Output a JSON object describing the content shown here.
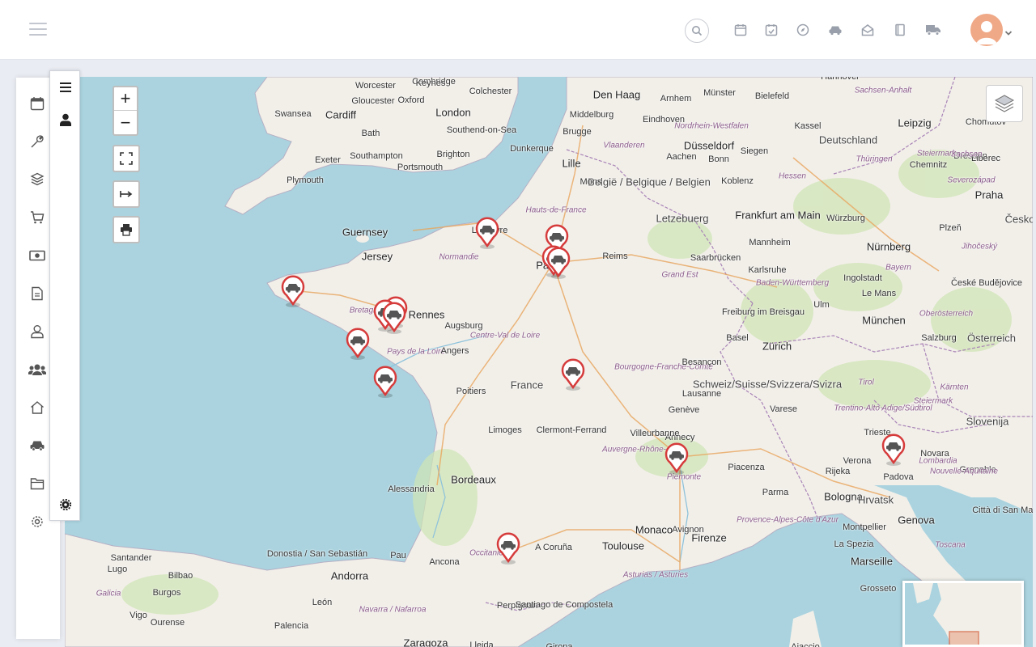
{
  "topbar": {
    "icons": [
      "hamburger-icon",
      "search-icon",
      "calendar-icon",
      "calendar-check-icon",
      "compass-icon",
      "car-icon",
      "envelope-open-icon",
      "book-icon",
      "truck-icon",
      "user-avatar",
      "chevron-down-icon"
    ]
  },
  "sidebar": {
    "items": [
      "calendar-icon",
      "wrench-icon",
      "cube-icon",
      "cart-icon",
      "money-icon",
      "document-icon",
      "user-icon",
      "users-icon",
      "home-icon",
      "car-icon",
      "folder-icon",
      "gear-icon"
    ]
  },
  "panel": {
    "items": [
      "menu-icon",
      "person-icon",
      "settings-icon"
    ]
  },
  "map": {
    "zoom_in": "+",
    "zoom_out": "−",
    "colors": {
      "water": "#aad3df",
      "land": "#f2efe9",
      "forest": "#cfe5b4",
      "marker": "#d63b3b"
    },
    "places": [
      {
        "name": "Den Haag",
        "cls": "big"
      },
      {
        "name": "Cambridge",
        "cls": ""
      },
      {
        "name": "Keynes",
        "cls": ""
      },
      {
        "name": "Worcester",
        "cls": ""
      },
      {
        "name": "Colchester",
        "cls": ""
      },
      {
        "name": "Oxford",
        "cls": ""
      },
      {
        "name": "London",
        "cls": "big"
      },
      {
        "name": "Swansea",
        "cls": ""
      },
      {
        "name": "Cardiff",
        "cls": "big"
      },
      {
        "name": "Gloucester",
        "cls": ""
      },
      {
        "name": "Southend-on-Sea",
        "cls": ""
      },
      {
        "name": "Bath",
        "cls": ""
      },
      {
        "name": "Middelburg",
        "cls": ""
      },
      {
        "name": "Brugge",
        "cls": ""
      },
      {
        "name": "Arnhem",
        "cls": ""
      },
      {
        "name": "Münster",
        "cls": ""
      },
      {
        "name": "Bielefeld",
        "cls": ""
      },
      {
        "name": "Hannover",
        "cls": ""
      },
      {
        "name": "Sachsen-Anhalt",
        "cls": "region"
      },
      {
        "name": "Leipzig",
        "cls": "big"
      },
      {
        "name": "Exeter",
        "cls": ""
      },
      {
        "name": "Southampton",
        "cls": ""
      },
      {
        "name": "Brighton",
        "cls": ""
      },
      {
        "name": "Dunkerque",
        "cls": ""
      },
      {
        "name": "Eindhoven",
        "cls": ""
      },
      {
        "name": "Düsseldorf",
        "cls": "big"
      },
      {
        "name": "Nordrhein-Westfalen",
        "cls": "region"
      },
      {
        "name": "Kassel",
        "cls": ""
      },
      {
        "name": "Deutschland",
        "cls": "country"
      },
      {
        "name": "Plymouth",
        "cls": ""
      },
      {
        "name": "Portsmouth",
        "cls": ""
      },
      {
        "name": "Lille",
        "cls": "big"
      },
      {
        "name": "Vlaanderen",
        "cls": "region"
      },
      {
        "name": "Aachen",
        "cls": ""
      },
      {
        "name": "Siegen",
        "cls": ""
      },
      {
        "name": "Thüringen",
        "cls": "region"
      },
      {
        "name": "Chemnitz",
        "cls": ""
      },
      {
        "name": "Dresden",
        "cls": ""
      },
      {
        "name": "België / Belgique / Belgien",
        "cls": "country"
      },
      {
        "name": "Bonn",
        "cls": ""
      },
      {
        "name": "Mons",
        "cls": ""
      },
      {
        "name": "Koblenz",
        "cls": ""
      },
      {
        "name": "Hessen",
        "cls": "region"
      },
      {
        "name": "Praha",
        "cls": "big"
      },
      {
        "name": "Hauts-de-France",
        "cls": "region"
      },
      {
        "name": "Frankfurt am Main",
        "cls": "big"
      },
      {
        "name": "Würzburg",
        "cls": ""
      },
      {
        "name": "Letzebuerg",
        "cls": "country"
      },
      {
        "name": "Guernsey",
        "cls": "big"
      },
      {
        "name": "Le Havre",
        "cls": ""
      },
      {
        "name": "Plzeň",
        "cls": ""
      },
      {
        "name": "Jersey",
        "cls": "big"
      },
      {
        "name": "Normandie",
        "cls": "region"
      },
      {
        "name": "Reims",
        "cls": ""
      },
      {
        "name": "Mannheim",
        "cls": ""
      },
      {
        "name": "Nürnberg",
        "cls": "big"
      },
      {
        "name": "Saarbrücken",
        "cls": ""
      },
      {
        "name": "Paris",
        "cls": "big"
      },
      {
        "name": "Karlsruhe",
        "cls": ""
      },
      {
        "name": "Grand Est",
        "cls": "region"
      },
      {
        "name": "Ingolstadt",
        "cls": ""
      },
      {
        "name": "Bayern",
        "cls": "region"
      },
      {
        "name": "Baden-Württemberg",
        "cls": "region"
      },
      {
        "name": "Rennes",
        "cls": "big"
      },
      {
        "name": "Bretagne",
        "cls": "region"
      },
      {
        "name": "Augsburg",
        "cls": ""
      },
      {
        "name": "Le Mans",
        "cls": ""
      },
      {
        "name": "Freiburg im Breisgau",
        "cls": ""
      },
      {
        "name": "Ulm",
        "cls": ""
      },
      {
        "name": "München",
        "cls": "big"
      },
      {
        "name": "Oberösterreich",
        "cls": "region"
      },
      {
        "name": "Salzburg",
        "cls": ""
      },
      {
        "name": "Österreich",
        "cls": "country"
      },
      {
        "name": "Centre-Val de Loire",
        "cls": "region"
      },
      {
        "name": "Pays de la Loire",
        "cls": "region"
      },
      {
        "name": "Angers",
        "cls": ""
      },
      {
        "name": "Basel",
        "cls": ""
      },
      {
        "name": "Zürich",
        "cls": "big"
      },
      {
        "name": "Tirol",
        "cls": "region"
      },
      {
        "name": "Steiermark",
        "cls": "region"
      },
      {
        "name": "Bourgogne-Franche-Comté",
        "cls": "region"
      },
      {
        "name": "Besançon",
        "cls": ""
      },
      {
        "name": "Schweiz/Suisse/Svizzera/Svizra",
        "cls": "country"
      },
      {
        "name": "France",
        "cls": "country"
      },
      {
        "name": "Poitiers",
        "cls": ""
      },
      {
        "name": "Lausanne",
        "cls": ""
      },
      {
        "name": "Trentino-Alto Adige/Südtirol",
        "cls": "region"
      },
      {
        "name": "Kärnten",
        "cls": "region"
      },
      {
        "name": "Genève",
        "cls": ""
      },
      {
        "name": "Slovenija",
        "cls": "country"
      },
      {
        "name": "Clermont-Ferrand",
        "cls": ""
      },
      {
        "name": "Annecy",
        "cls": ""
      },
      {
        "name": "Limoges",
        "cls": ""
      },
      {
        "name": "Villeurbanne",
        "cls": ""
      },
      {
        "name": "Varese",
        "cls": ""
      },
      {
        "name": "Trieste",
        "cls": ""
      },
      {
        "name": "Auvergne-Rhône-Alpes",
        "cls": "region"
      },
      {
        "name": "Novara",
        "cls": ""
      },
      {
        "name": "Lombardia",
        "cls": "region"
      },
      {
        "name": "Verona",
        "cls": ""
      },
      {
        "name": "Padova",
        "cls": ""
      },
      {
        "name": "Grenoble",
        "cls": ""
      },
      {
        "name": "Piemonte",
        "cls": "region"
      },
      {
        "name": "Piacenza",
        "cls": ""
      },
      {
        "name": "Rijeka",
        "cls": ""
      },
      {
        "name": "Nouvelle-Aquitaine",
        "cls": "region"
      },
      {
        "name": "Bordeaux",
        "cls": "big"
      },
      {
        "name": "Alessandria",
        "cls": ""
      },
      {
        "name": "Parma",
        "cls": ""
      },
      {
        "name": "Bologna",
        "cls": "big"
      },
      {
        "name": "Hrvatsk",
        "cls": "country"
      },
      {
        "name": "Città di San Marino",
        "cls": ""
      },
      {
        "name": "Genova",
        "cls": "big"
      },
      {
        "name": "Provence-Alpes-Côte d'Azur",
        "cls": "region"
      },
      {
        "name": "Avignon",
        "cls": ""
      },
      {
        "name": "Monaco",
        "cls": "big"
      },
      {
        "name": "Firenze",
        "cls": "big"
      },
      {
        "name": "La Spezia",
        "cls": ""
      },
      {
        "name": "Montpellier",
        "cls": ""
      },
      {
        "name": "Toulouse",
        "cls": "big"
      },
      {
        "name": "Occitanie",
        "cls": "region"
      },
      {
        "name": "A Coruña",
        "cls": ""
      },
      {
        "name": "Santander",
        "cls": ""
      },
      {
        "name": "Donostia / San Sebastián",
        "cls": ""
      },
      {
        "name": "Pau",
        "cls": ""
      },
      {
        "name": "Ancona",
        "cls": ""
      },
      {
        "name": "Toscana",
        "cls": "region"
      },
      {
        "name": "Marseille",
        "cls": "big"
      },
      {
        "name": "Asturias / Asturies",
        "cls": "region"
      },
      {
        "name": "Lugo",
        "cls": ""
      },
      {
        "name": "Bilbao",
        "cls": ""
      },
      {
        "name": "Andorra",
        "cls": "big"
      },
      {
        "name": "Perpignan",
        "cls": ""
      },
      {
        "name": "Santiago de Compostela",
        "cls": ""
      },
      {
        "name": "Galicia",
        "cls": "region"
      },
      {
        "name": "Burgos",
        "cls": ""
      },
      {
        "name": "León",
        "cls": ""
      },
      {
        "name": "Navarra / Nafarroa",
        "cls": "region"
      },
      {
        "name": "Grosseto",
        "cls": ""
      },
      {
        "name": "Vigo",
        "cls": ""
      },
      {
        "name": "Ourense",
        "cls": ""
      },
      {
        "name": "Palencia",
        "cls": ""
      },
      {
        "name": "Zaragoza",
        "cls": "big"
      },
      {
        "name": "Lleida",
        "cls": ""
      },
      {
        "name": "Girona",
        "cls": ""
      },
      {
        "name": "Ajaccio",
        "cls": ""
      },
      {
        "name": "Liberec",
        "cls": ""
      },
      {
        "name": "Chomutov",
        "cls": ""
      },
      {
        "name": "Jihočeský",
        "cls": "region"
      },
      {
        "name": "České Budějovice",
        "cls": ""
      },
      {
        "name": "Sachsen",
        "cls": "region"
      },
      {
        "name": "Severozápad",
        "cls": "region"
      },
      {
        "name": "Česko",
        "cls": "country"
      },
      {
        "name": "Steiermark",
        "cls": "region"
      }
    ],
    "markers": 14
  }
}
